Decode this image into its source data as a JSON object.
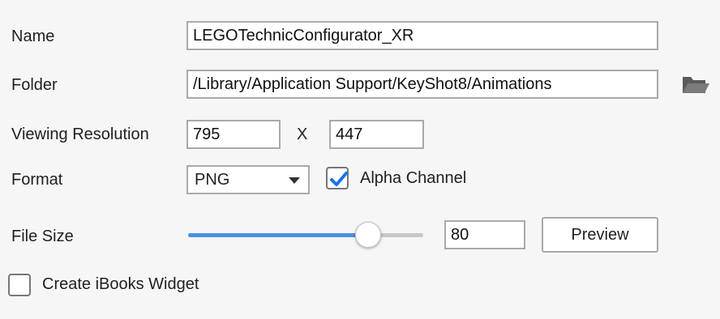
{
  "form": {
    "name": {
      "label": "Name",
      "value": "LEGOTechnicConfigurator_XR"
    },
    "folder": {
      "label": "Folder",
      "value": "/Library/Application Support/KeyShot8/Animations",
      "browse_icon": "folder-open-icon"
    },
    "resolution": {
      "label": "Viewing Resolution",
      "width": "795",
      "separator": "X",
      "height": "447"
    },
    "format": {
      "label": "Format",
      "selected": "PNG",
      "alpha_label": "Alpha Channel",
      "alpha_checked": true
    },
    "file_size": {
      "label": "File Size",
      "value": "80",
      "slider_fraction": 0.8,
      "preview_label": "Preview"
    },
    "ibooks": {
      "label": "Create iBooks Widget",
      "checked": false
    }
  },
  "colors": {
    "accent": "#1a73e8",
    "slider_fill": "#4a90e2",
    "slider_track": "#c7c7c7"
  }
}
